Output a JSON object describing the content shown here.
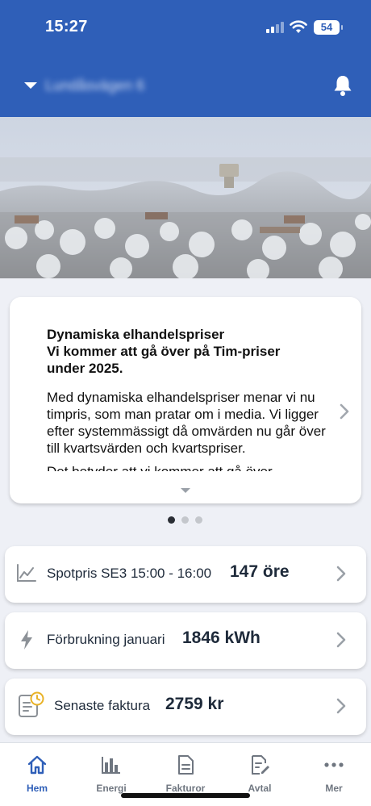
{
  "status": {
    "time": "15:27",
    "battery": "54"
  },
  "header": {
    "address": "Lundåsvägen 6"
  },
  "news": {
    "title": "Dynamiska elhandelspriser\nVi kommer att gå över på Tim-priser under 2025.",
    "body": "Med dynamiska elhandelspriser menar vi nu timpris, som man pratar om i media. Vi ligger efter systemmässigt då omvärden nu går över till kvartsvärden och kvartspriser.",
    "more": "Det betyder att vi kommer att gå över"
  },
  "carousel": {
    "pages": 3,
    "active": 0
  },
  "cards": [
    {
      "label": "Spotpris SE3 15:00 - 16:00",
      "value": "147 öre",
      "icon": "chart-line-icon"
    },
    {
      "label": "Förbrukning januari",
      "value": "1846 kWh",
      "icon": "lightning-icon"
    },
    {
      "label": "Senaste faktura",
      "value": "2759 kr",
      "icon": "invoice-clock-icon"
    }
  ],
  "tabs": [
    {
      "label": "Hem",
      "icon": "home-icon",
      "active": true
    },
    {
      "label": "Energi",
      "icon": "bar-chart-icon",
      "active": false
    },
    {
      "label": "Fakturor",
      "icon": "document-icon",
      "active": false
    },
    {
      "label": "Avtal",
      "icon": "contract-edit-icon",
      "active": false
    },
    {
      "label": "Mer",
      "icon": "more-icon",
      "active": false
    }
  ],
  "colors": {
    "brand": "#2f5fb8",
    "text": "#1e2a3a",
    "muted": "#6f7680",
    "background": "#eef0f6",
    "icon_accent": "#e9b227"
  }
}
